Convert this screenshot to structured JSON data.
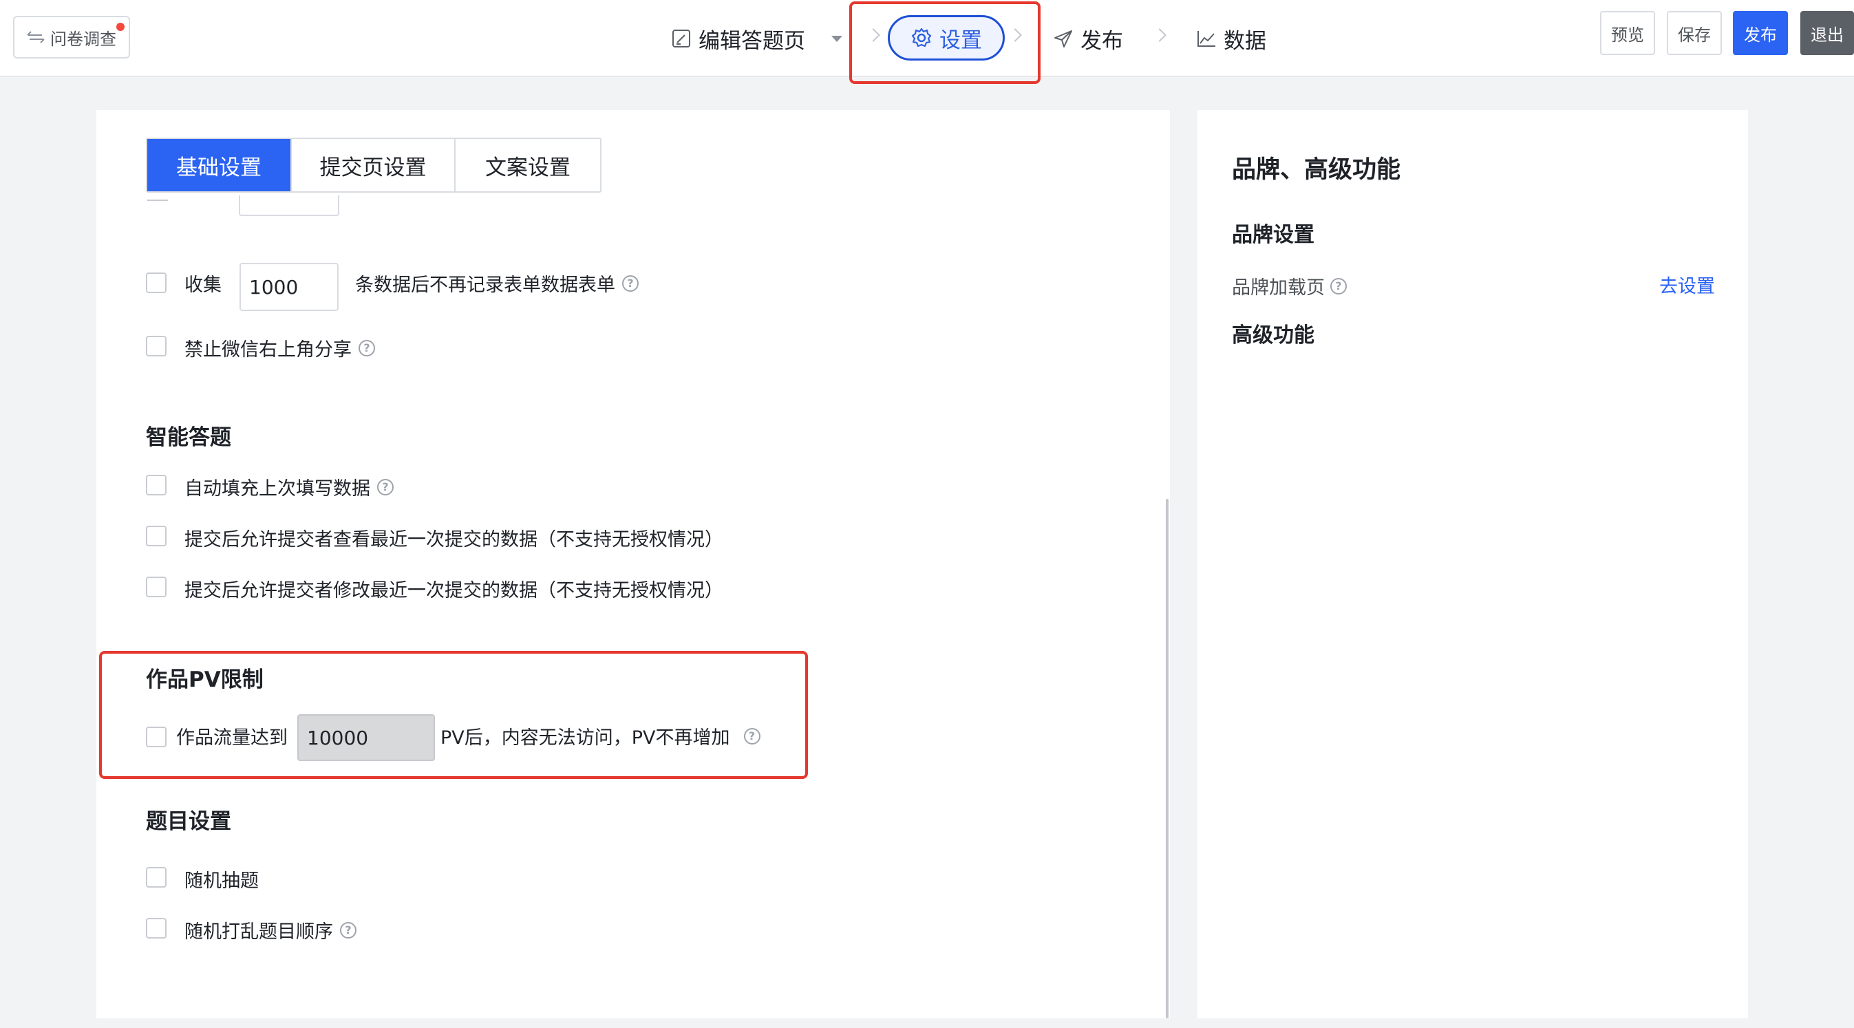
{
  "header": {
    "back_label": "问卷调查",
    "steps": {
      "edit": "编辑答题页",
      "settings": "设置",
      "publish": "发布",
      "data": "数据"
    },
    "buttons": {
      "preview": "预览",
      "save": "保存",
      "publish": "发布",
      "exit": "退出"
    }
  },
  "tabs": [
    "基础设置",
    "提交页设置",
    "文案设置"
  ],
  "collect": {
    "prefix": "收集",
    "value": "1000",
    "suffix": "条数据后不再记录表单数据表单"
  },
  "disable_share": "禁止微信右上角分享",
  "smart": {
    "title": "智能答题",
    "items": [
      "自动填充上次填写数据",
      "提交后允许提交者查看最近一次提交的数据（不支持无授权情况）",
      "提交后允许提交者修改最近一次提交的数据（不支持无授权情况）"
    ]
  },
  "pv_limit": {
    "title": "作品PV限制",
    "prefix": "作品流量达到",
    "value": "10000",
    "suffix": "PV后，内容无法访问，PV不再增加"
  },
  "question_settings": {
    "title": "题目设置",
    "items": [
      "随机抽题",
      "随机打乱题目顺序"
    ]
  },
  "side": {
    "title": "品牌、高级功能",
    "brand_settings": "品牌设置",
    "brand_loading": "品牌加载页",
    "go_settings": "去设置",
    "advanced": "高级功能"
  },
  "colors": {
    "primary": "#2b63f2",
    "highlight_border": "#e5382e",
    "exit_button": "#5b5f66"
  }
}
